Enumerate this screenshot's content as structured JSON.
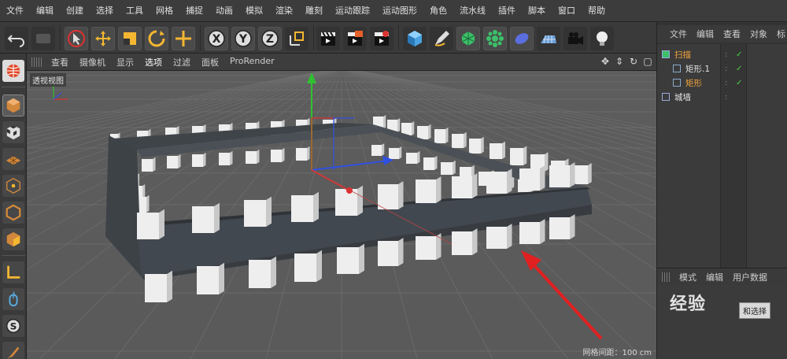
{
  "menu": [
    "文件",
    "编辑",
    "创建",
    "选择",
    "工具",
    "网格",
    "捕捉",
    "动画",
    "模拟",
    "渲染",
    "雕刻",
    "运动跟踪",
    "运动图形",
    "角色",
    "流水线",
    "插件",
    "脚本",
    "窗口",
    "帮助"
  ],
  "toolbar": {
    "x_label": "X",
    "y_label": "Y",
    "z_label": "Z"
  },
  "viewport": {
    "menu": [
      "查看",
      "摄像机",
      "显示",
      "选项",
      "过滤",
      "面板",
      "ProRender"
    ],
    "active_menu": "选项",
    "label": "透视视图",
    "grid_info": "网格间距：100 cm"
  },
  "object_manager": {
    "tabs": [
      "文件",
      "编辑",
      "查看",
      "对象",
      "标"
    ],
    "objects": [
      {
        "name": "扫描",
        "selected": true,
        "level": 0
      },
      {
        "name": "矩形.1",
        "selected": false,
        "level": 1
      },
      {
        "name": "矩形",
        "selected": true,
        "level": 1
      },
      {
        "name": "城墙",
        "selected": false,
        "level": 0
      }
    ]
  },
  "attribute_manager": {
    "tabs": [
      "模式",
      "编辑",
      "用户数据"
    ],
    "watermark": "经验",
    "tooltip": "和选择"
  },
  "colors": {
    "accent": "#f2a33a",
    "axis_x": "#e03030",
    "axis_y": "#30c030",
    "axis_z": "#3050e0",
    "check": "#4cd04c"
  }
}
